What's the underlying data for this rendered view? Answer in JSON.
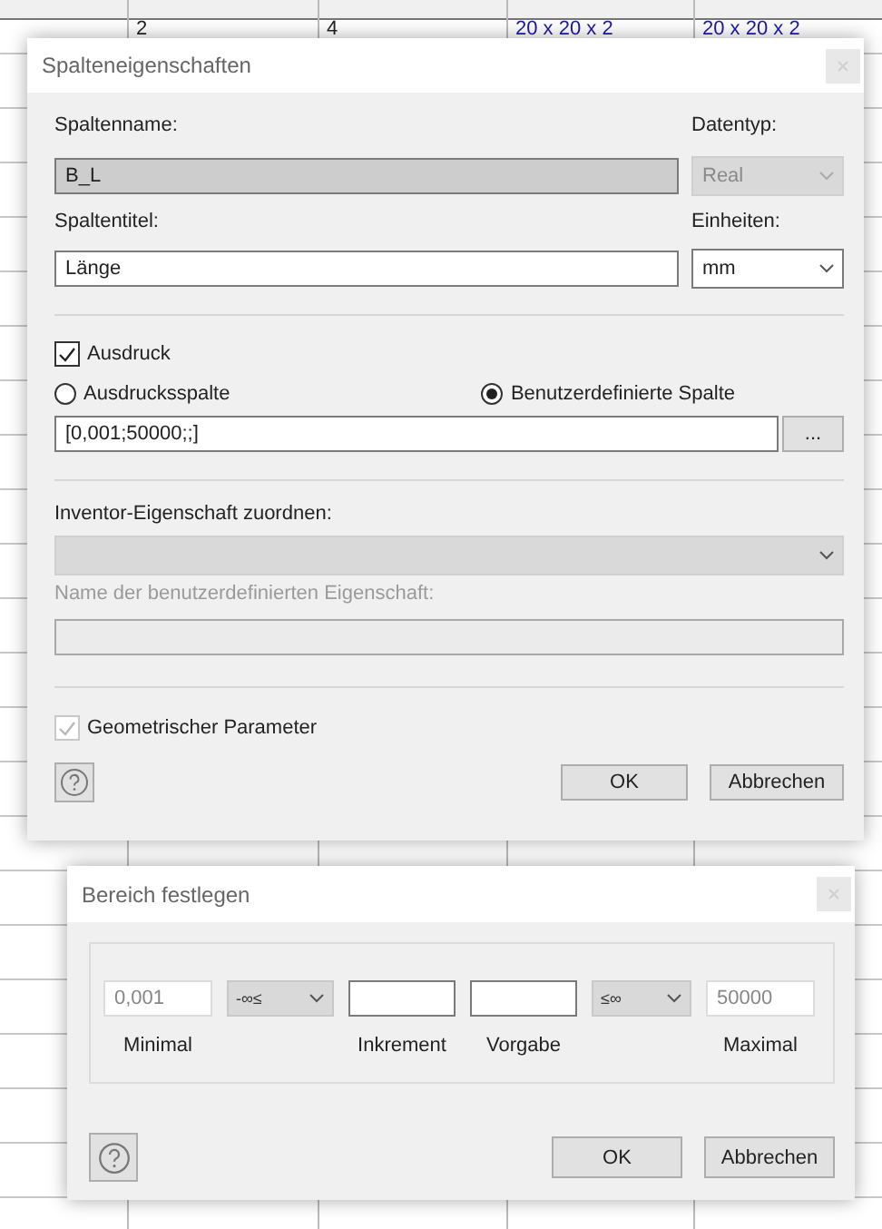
{
  "background_table": {
    "rows": [
      {
        "cells": [
          "2",
          "4",
          "20 x 20 x 2",
          "20 x 20 x 2"
        ]
      }
    ]
  },
  "column_dialog": {
    "title": "Spalteneigenschaften",
    "name_label": "Spaltenname:",
    "name_value": "B_L",
    "name_disabled": true,
    "datatype_label": "Datentyp:",
    "datatype_value": "Real",
    "datatype_disabled": true,
    "title_label": "Spaltentitel:",
    "title_value": "Länge",
    "units_label": "Einheiten:",
    "units_value": "mm",
    "units_disabled": false,
    "expression": {
      "label": "Ausdruck",
      "checked": true,
      "disabled": false
    },
    "radios": [
      {
        "label": "Ausdrucksspalte",
        "selected": false
      },
      {
        "label": "Benutzerdefinierte Spalte",
        "selected": true
      }
    ],
    "expression_value": "[0,001;50000;;]",
    "browse_button": "...",
    "inventor_label": "Inventor-Eigenschaft zuordnen:",
    "inventor_disabled": true,
    "custom_name_label": "Name der benutzerdefinierten Eigenschaft:",
    "custom_name_disabled": true,
    "geometric": {
      "label": "Geometrischer Parameter",
      "checked": true,
      "disabled": true
    },
    "buttons": [
      "OK",
      "Abbrechen"
    ]
  },
  "range_dialog": {
    "title": "Bereich festlegen",
    "fields": [
      {
        "kind": "input",
        "value": "0,001",
        "label": "Minimal",
        "disabled": true
      },
      {
        "kind": "select",
        "value": "-∞≤"
      },
      {
        "kind": "input",
        "label": "Inkrement",
        "disabled": false
      },
      {
        "kind": "input",
        "label": "Vorgabe",
        "disabled": false
      },
      {
        "kind": "select",
        "value": "≤∞"
      },
      {
        "kind": "input",
        "value": "50000",
        "label": "Maximal",
        "disabled": true
      }
    ],
    "buttons": [
      "OK",
      "Abbrechen"
    ]
  }
}
